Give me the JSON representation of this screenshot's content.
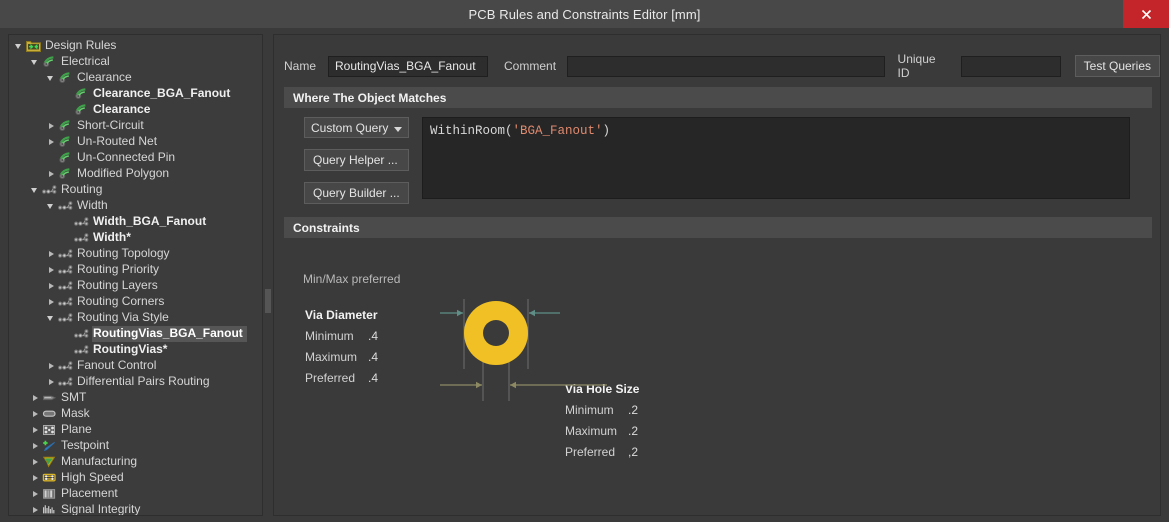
{
  "window": {
    "title": "PCB Rules and Constraints Editor [mm]",
    "close_icon": "close-icon",
    "close_bg": "#c4252a"
  },
  "tree": {
    "items": [
      {
        "label": "Design Rules",
        "indent": 0,
        "twisty": "expanded",
        "icon": "folder-rules-icon",
        "bold": false,
        "selected": false
      },
      {
        "label": "Electrical",
        "indent": 1,
        "twisty": "expanded",
        "icon": "electrical-icon",
        "bold": false,
        "selected": false
      },
      {
        "label": "Clearance",
        "indent": 2,
        "twisty": "expanded",
        "icon": "electrical-icon",
        "bold": false,
        "selected": false
      },
      {
        "label": "Clearance_BGA_Fanout",
        "indent": 3,
        "twisty": "none",
        "icon": "electrical-icon",
        "bold": true,
        "selected": false
      },
      {
        "label": "Clearance",
        "indent": 3,
        "twisty": "none",
        "icon": "electrical-icon",
        "bold": true,
        "selected": false
      },
      {
        "label": "Short-Circuit",
        "indent": 2,
        "twisty": "collapsed",
        "icon": "electrical-icon",
        "bold": false,
        "selected": false
      },
      {
        "label": "Un-Routed Net",
        "indent": 2,
        "twisty": "collapsed",
        "icon": "electrical-icon",
        "bold": false,
        "selected": false
      },
      {
        "label": "Un-Connected Pin",
        "indent": 2,
        "twisty": "none",
        "icon": "electrical-icon",
        "bold": false,
        "selected": false
      },
      {
        "label": "Modified Polygon",
        "indent": 2,
        "twisty": "collapsed",
        "icon": "electrical-icon",
        "bold": false,
        "selected": false
      },
      {
        "label": "Routing",
        "indent": 1,
        "twisty": "expanded",
        "icon": "routing-icon",
        "bold": false,
        "selected": false
      },
      {
        "label": "Width",
        "indent": 2,
        "twisty": "expanded",
        "icon": "routing-icon",
        "bold": false,
        "selected": false
      },
      {
        "label": "Width_BGA_Fanout",
        "indent": 3,
        "twisty": "none",
        "icon": "routing-icon",
        "bold": true,
        "selected": false
      },
      {
        "label": "Width*",
        "indent": 3,
        "twisty": "none",
        "icon": "routing-icon",
        "bold": true,
        "selected": false
      },
      {
        "label": "Routing Topology",
        "indent": 2,
        "twisty": "collapsed",
        "icon": "routing-icon",
        "bold": false,
        "selected": false
      },
      {
        "label": "Routing Priority",
        "indent": 2,
        "twisty": "collapsed",
        "icon": "routing-icon",
        "bold": false,
        "selected": false
      },
      {
        "label": "Routing Layers",
        "indent": 2,
        "twisty": "collapsed",
        "icon": "routing-icon",
        "bold": false,
        "selected": false
      },
      {
        "label": "Routing Corners",
        "indent": 2,
        "twisty": "collapsed",
        "icon": "routing-icon",
        "bold": false,
        "selected": false
      },
      {
        "label": "Routing Via Style",
        "indent": 2,
        "twisty": "expanded",
        "icon": "routing-icon",
        "bold": false,
        "selected": false
      },
      {
        "label": "RoutingVias_BGA_Fanout",
        "indent": 3,
        "twisty": "none",
        "icon": "routing-icon",
        "bold": true,
        "selected": true
      },
      {
        "label": "RoutingVias*",
        "indent": 3,
        "twisty": "none",
        "icon": "routing-icon",
        "bold": true,
        "selected": false
      },
      {
        "label": "Fanout Control",
        "indent": 2,
        "twisty": "collapsed",
        "icon": "routing-icon",
        "bold": false,
        "selected": false
      },
      {
        "label": "Differential Pairs Routing",
        "indent": 2,
        "twisty": "collapsed",
        "icon": "routing-icon",
        "bold": false,
        "selected": false
      },
      {
        "label": "SMT",
        "indent": 1,
        "twisty": "collapsed",
        "icon": "smt-icon",
        "bold": false,
        "selected": false
      },
      {
        "label": "Mask",
        "indent": 1,
        "twisty": "collapsed",
        "icon": "mask-icon",
        "bold": false,
        "selected": false
      },
      {
        "label": "Plane",
        "indent": 1,
        "twisty": "collapsed",
        "icon": "plane-icon",
        "bold": false,
        "selected": false
      },
      {
        "label": "Testpoint",
        "indent": 1,
        "twisty": "collapsed",
        "icon": "testpoint-icon",
        "bold": false,
        "selected": false
      },
      {
        "label": "Manufacturing",
        "indent": 1,
        "twisty": "collapsed",
        "icon": "manufacturing-icon",
        "bold": false,
        "selected": false
      },
      {
        "label": "High Speed",
        "indent": 1,
        "twisty": "collapsed",
        "icon": "highspeed-icon",
        "bold": false,
        "selected": false
      },
      {
        "label": "Placement",
        "indent": 1,
        "twisty": "collapsed",
        "icon": "placement-icon",
        "bold": false,
        "selected": false
      },
      {
        "label": "Signal Integrity",
        "indent": 1,
        "twisty": "collapsed",
        "icon": "signal-integrity-icon",
        "bold": false,
        "selected": false
      }
    ]
  },
  "form": {
    "name_label": "Name",
    "name_value": "RoutingVias_BGA_Fanout",
    "comment_label": "Comment",
    "comment_value": "",
    "unique_id_label": "Unique ID",
    "unique_id_value": "",
    "test_queries_label": "Test Queries"
  },
  "where_section": {
    "title": "Where The Object Matches",
    "query_type": "Custom Query",
    "query_helper_label": "Query Helper ...",
    "query_builder_label": "Query Builder ...",
    "query_fn": "WithinRoom(",
    "query_string": "'BGA_Fanout'",
    "query_tail": ")"
  },
  "constraints_section": {
    "title": "Constraints",
    "minmax_label": "Min/Max preferred",
    "via_diameter": {
      "title": "Via Diameter",
      "minimum_label": "Minimum",
      "minimum_value": ".4",
      "maximum_label": "Maximum",
      "maximum_value": ".4",
      "preferred_label": "Preferred",
      "preferred_value": ".4"
    },
    "via_hole_size": {
      "title": "Via Hole Size",
      "minimum_label": "Minimum",
      "minimum_value": ".2",
      "maximum_label": "Maximum",
      "maximum_value": ".2",
      "preferred_label": "Preferred",
      "preferred_value": ",2"
    },
    "figure": {
      "pad_color": "#F0C024",
      "hole_color": "#3a3a3a",
      "diameter_arrow_color": "#5e8e86",
      "hole_arrow_color": "#8d8a63",
      "guide_color": "#6e6e6e"
    }
  }
}
